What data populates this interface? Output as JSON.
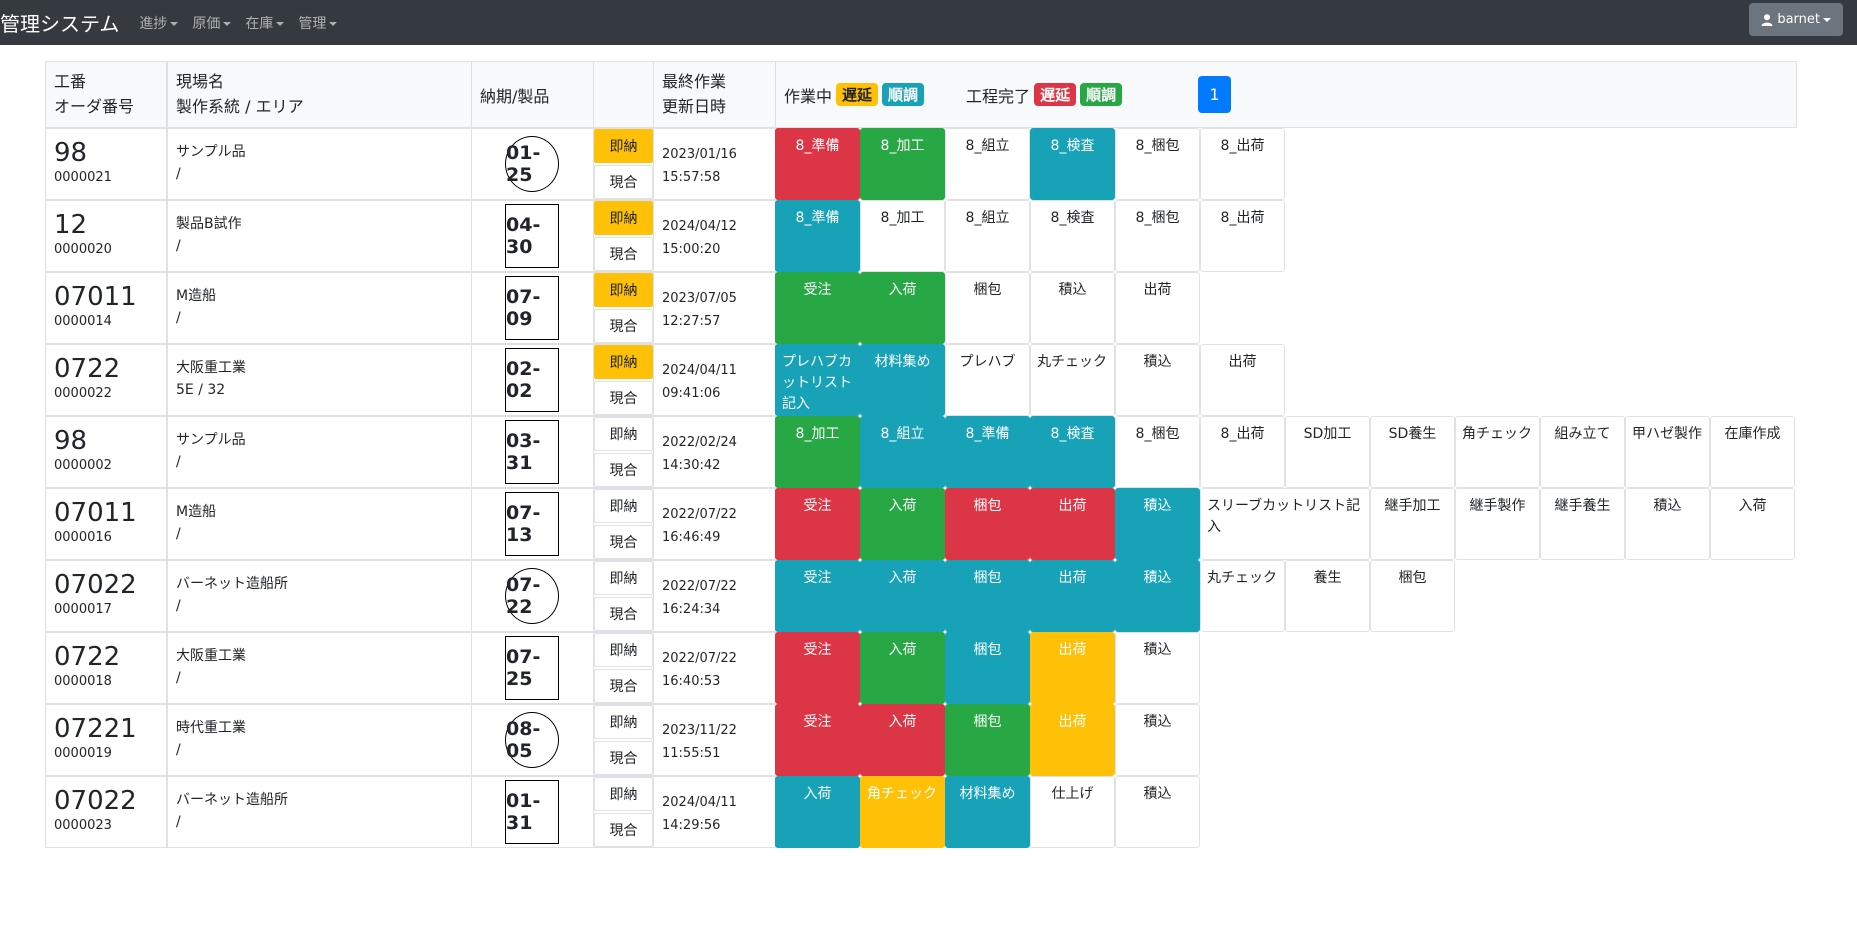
{
  "nav": {
    "brand": "管理システム",
    "menus": [
      "進捗",
      "原価",
      "在庫",
      "管理"
    ],
    "user": "barnet"
  },
  "colors": {
    "red": "#dc3545",
    "green": "#28a745",
    "teal": "#17a2b8",
    "yellow": "#ffc107",
    "white": "#ffffff",
    "primary": "#007bff"
  },
  "header": {
    "col1": "工番\nオーダ番号",
    "col2": "現場名\n製作系統 / エリア",
    "col3": "納期/製品",
    "col5": "最終作業\n更新日時",
    "working_label": "作業中",
    "done_label": "工程完了",
    "delay_label": "遅延",
    "ontrack_label": "順調",
    "page": "1"
  },
  "rows": [
    {
      "koban": "98",
      "order": "0000021",
      "site": "サンプル品",
      "sub": "/",
      "date": "01-25",
      "shape": "circle",
      "sokunou_active": true,
      "sokunou": "即納",
      "genai": "現合",
      "updated": "2023/01/16\n15:57:58",
      "steps": [
        {
          "label": "8_準備",
          "color": "red"
        },
        {
          "label": "8_加工",
          "color": "green"
        },
        {
          "label": "8_組立",
          "color": "white"
        },
        {
          "label": "8_検査",
          "color": "teal"
        },
        {
          "label": "8_梱包",
          "color": "white"
        },
        {
          "label": "8_出荷",
          "color": "white"
        }
      ]
    },
    {
      "koban": "12",
      "order": "0000020",
      "site": "製品B試作",
      "sub": "/",
      "date": "04-30",
      "shape": "rect",
      "sokunou_active": true,
      "sokunou": "即納",
      "genai": "現合",
      "updated": "2024/04/12\n15:00:20",
      "steps": [
        {
          "label": "8_準備",
          "color": "teal"
        },
        {
          "label": "8_加工",
          "color": "white"
        },
        {
          "label": "8_組立",
          "color": "white"
        },
        {
          "label": "8_検査",
          "color": "white"
        },
        {
          "label": "8_梱包",
          "color": "white"
        },
        {
          "label": "8_出荷",
          "color": "white"
        }
      ]
    },
    {
      "koban": "07011",
      "order": "0000014",
      "site": "M造船",
      "sub": "/",
      "date": "07-09",
      "shape": "rect",
      "sokunou_active": true,
      "sokunou": "即納",
      "genai": "現合",
      "updated": "2023/07/05\n12:27:57",
      "steps": [
        {
          "label": "受注",
          "color": "green"
        },
        {
          "label": "入荷",
          "color": "green"
        },
        {
          "label": "梱包",
          "color": "white"
        },
        {
          "label": "積込",
          "color": "white"
        },
        {
          "label": "出荷",
          "color": "white"
        }
      ]
    },
    {
      "koban": "0722",
      "order": "0000022",
      "site": "大阪重工業",
      "sub": "5E / 32",
      "date": "02-02",
      "shape": "rect",
      "sokunou_active": true,
      "sokunou": "即納",
      "genai": "現合",
      "updated": "2024/04/11\n09:41:06",
      "steps": [
        {
          "label": "プレハブカットリスト記入",
          "color": "teal",
          "left": true
        },
        {
          "label": "材料集め",
          "color": "teal"
        },
        {
          "label": "プレハブ",
          "color": "white"
        },
        {
          "label": "丸チェック",
          "color": "white",
          "left": true
        },
        {
          "label": "積込",
          "color": "white"
        },
        {
          "label": "出荷",
          "color": "white"
        }
      ]
    },
    {
      "koban": "98",
      "order": "0000002",
      "site": "サンプル品",
      "sub": "/",
      "date": "03-31",
      "shape": "rect",
      "sokunou_active": false,
      "sokunou": "即納",
      "genai": "現合",
      "updated": "2022/02/24\n14:30:42",
      "steps": [
        {
          "label": "8_加工",
          "color": "green"
        },
        {
          "label": "8_組立",
          "color": "teal"
        },
        {
          "label": "8_準備",
          "color": "teal"
        },
        {
          "label": "8_検査",
          "color": "teal"
        },
        {
          "label": "8_梱包",
          "color": "white"
        },
        {
          "label": "8_出荷",
          "color": "white"
        },
        {
          "label": "SD加工",
          "color": "white"
        },
        {
          "label": "SD養生",
          "color": "white"
        },
        {
          "label": "角チェック",
          "color": "white",
          "left": true
        },
        {
          "label": "組み立て",
          "color": "white"
        },
        {
          "label": "甲ハゼ製作",
          "color": "white",
          "left": true
        },
        {
          "label": "在庫作成",
          "color": "white"
        }
      ]
    },
    {
      "koban": "07011",
      "order": "0000016",
      "site": "M造船",
      "sub": "/",
      "date": "07-13",
      "shape": "rect",
      "sokunou_active": false,
      "sokunou": "即納",
      "genai": "現合",
      "updated": "2022/07/22\n16:46:49",
      "steps": [
        {
          "label": "受注",
          "color": "red"
        },
        {
          "label": "入荷",
          "color": "green"
        },
        {
          "label": "梱包",
          "color": "red"
        },
        {
          "label": "出荷",
          "color": "red"
        },
        {
          "label": "積込",
          "color": "teal"
        },
        {
          "label": "スリーブカットリスト記入",
          "color": "white",
          "left": true,
          "span": 2
        },
        {
          "label": "継手加工",
          "color": "white"
        },
        {
          "label": "継手製作",
          "color": "white"
        },
        {
          "label": "継手養生",
          "color": "white"
        },
        {
          "label": "積込",
          "color": "white"
        },
        {
          "label": "入荷",
          "color": "white"
        }
      ]
    },
    {
      "koban": "07022",
      "order": "0000017",
      "site": "バーネット造船所",
      "sub": "/",
      "date": "07-22",
      "shape": "circle",
      "sokunou_active": false,
      "sokunou": "即納",
      "genai": "現合",
      "updated": "2022/07/22\n16:24:34",
      "steps": [
        {
          "label": "受注",
          "color": "teal"
        },
        {
          "label": "入荷",
          "color": "teal"
        },
        {
          "label": "梱包",
          "color": "teal"
        },
        {
          "label": "出荷",
          "color": "teal"
        },
        {
          "label": "積込",
          "color": "teal"
        },
        {
          "label": "丸チェック",
          "color": "white",
          "left": true
        },
        {
          "label": "養生",
          "color": "white"
        },
        {
          "label": "梱包",
          "color": "white"
        }
      ]
    },
    {
      "koban": "0722",
      "order": "0000018",
      "site": "大阪重工業",
      "sub": "/",
      "date": "07-25",
      "shape": "rect",
      "sokunou_active": false,
      "sokunou": "即納",
      "genai": "現合",
      "updated": "2022/07/22\n16:40:53",
      "steps": [
        {
          "label": "受注",
          "color": "red"
        },
        {
          "label": "入荷",
          "color": "green"
        },
        {
          "label": "梱包",
          "color": "teal"
        },
        {
          "label": "出荷",
          "color": "yellow"
        },
        {
          "label": "積込",
          "color": "white"
        }
      ]
    },
    {
      "koban": "07221",
      "order": "0000019",
      "site": "時代重工業",
      "sub": "/",
      "date": "08-05",
      "shape": "circle",
      "sokunou_active": false,
      "sokunou": "即納",
      "genai": "現合",
      "updated": "2023/11/22\n11:55:51",
      "steps": [
        {
          "label": "受注",
          "color": "red"
        },
        {
          "label": "入荷",
          "color": "red"
        },
        {
          "label": "梱包",
          "color": "green"
        },
        {
          "label": "出荷",
          "color": "yellow"
        },
        {
          "label": "積込",
          "color": "white"
        }
      ]
    },
    {
      "koban": "07022",
      "order": "0000023",
      "site": "バーネット造船所",
      "sub": "/",
      "date": "01-31",
      "shape": "rect",
      "sokunou_active": false,
      "sokunou": "即納",
      "genai": "現合",
      "updated": "2024/04/11\n14:29:56",
      "steps": [
        {
          "label": "入荷",
          "color": "teal"
        },
        {
          "label": "角チェック",
          "color": "yellow",
          "left": true
        },
        {
          "label": "材料集め",
          "color": "teal"
        },
        {
          "label": "仕上げ",
          "color": "white"
        },
        {
          "label": "積込",
          "color": "white"
        }
      ]
    }
  ]
}
